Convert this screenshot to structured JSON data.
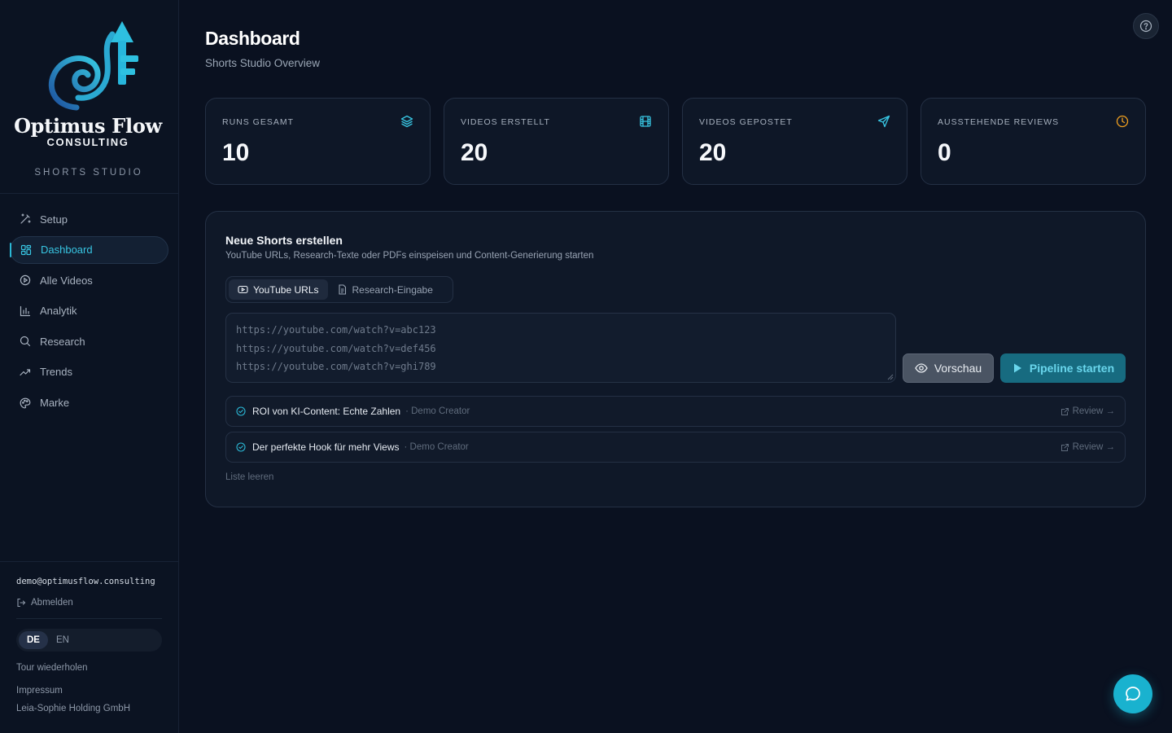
{
  "brand": {
    "name": "Optimus Flow",
    "sub": "CONSULTING",
    "studio": "SHORTS STUDIO"
  },
  "nav": [
    {
      "label": "Setup",
      "icon": "wand-icon"
    },
    {
      "label": "Dashboard",
      "icon": "grid-icon",
      "active": true
    },
    {
      "label": "Alle Videos",
      "icon": "play-circle-icon"
    },
    {
      "label": "Analytik",
      "icon": "bar-chart-icon"
    },
    {
      "label": "Research",
      "icon": "search-icon"
    },
    {
      "label": "Trends",
      "icon": "trend-icon"
    },
    {
      "label": "Marke",
      "icon": "palette-icon"
    }
  ],
  "account": {
    "email": "demo@optimusflow.consulting",
    "logout": "Abmelden"
  },
  "lang": {
    "de": "DE",
    "en": "EN",
    "active": "DE"
  },
  "footer": {
    "tour": "Tour wiederholen",
    "impressum": "Impressum",
    "holding": "Leia-Sophie Holding GmbH"
  },
  "header": {
    "title": "Dashboard",
    "subtitle": "Shorts Studio Overview"
  },
  "stats": [
    {
      "label": "RUNS GESAMT",
      "value": "10",
      "icon": "layers-icon"
    },
    {
      "label": "VIDEOS ERSTELLT",
      "value": "20",
      "icon": "film-icon"
    },
    {
      "label": "VIDEOS GEPOSTET",
      "value": "20",
      "icon": "send-icon"
    },
    {
      "label": "AUSSTEHENDE REVIEWS",
      "value": "0",
      "icon": "clock-icon"
    }
  ],
  "create": {
    "title": "Neue Shorts erstellen",
    "desc": "YouTube URLs, Research-Texte oder PDFs einspeisen und Content-Generierung starten",
    "tabs": [
      "YouTube URLs",
      "Research-Eingabe"
    ],
    "active_tab": "YouTube URLs",
    "placeholder": [
      "https://youtube.com/watch?v=abc123",
      "https://youtube.com/watch?v=def456",
      "https://youtube.com/watch?v=ghi789"
    ],
    "preview": "Vorschau",
    "run": "Pipeline starten",
    "items": [
      {
        "title": "ROI von KI-Content: Echte Zahlen",
        "creator": "· Demo Creator",
        "review": "Review →"
      },
      {
        "title": "Der perfekte Hook für mehr Views",
        "creator": "· Demo Creator",
        "review": "Review →"
      }
    ],
    "clear": "Liste leeren"
  },
  "colors": {
    "accent": "#2bb8d6",
    "bg": "#0a1120",
    "panel": "#0f1828",
    "warning": "#f0a020"
  }
}
